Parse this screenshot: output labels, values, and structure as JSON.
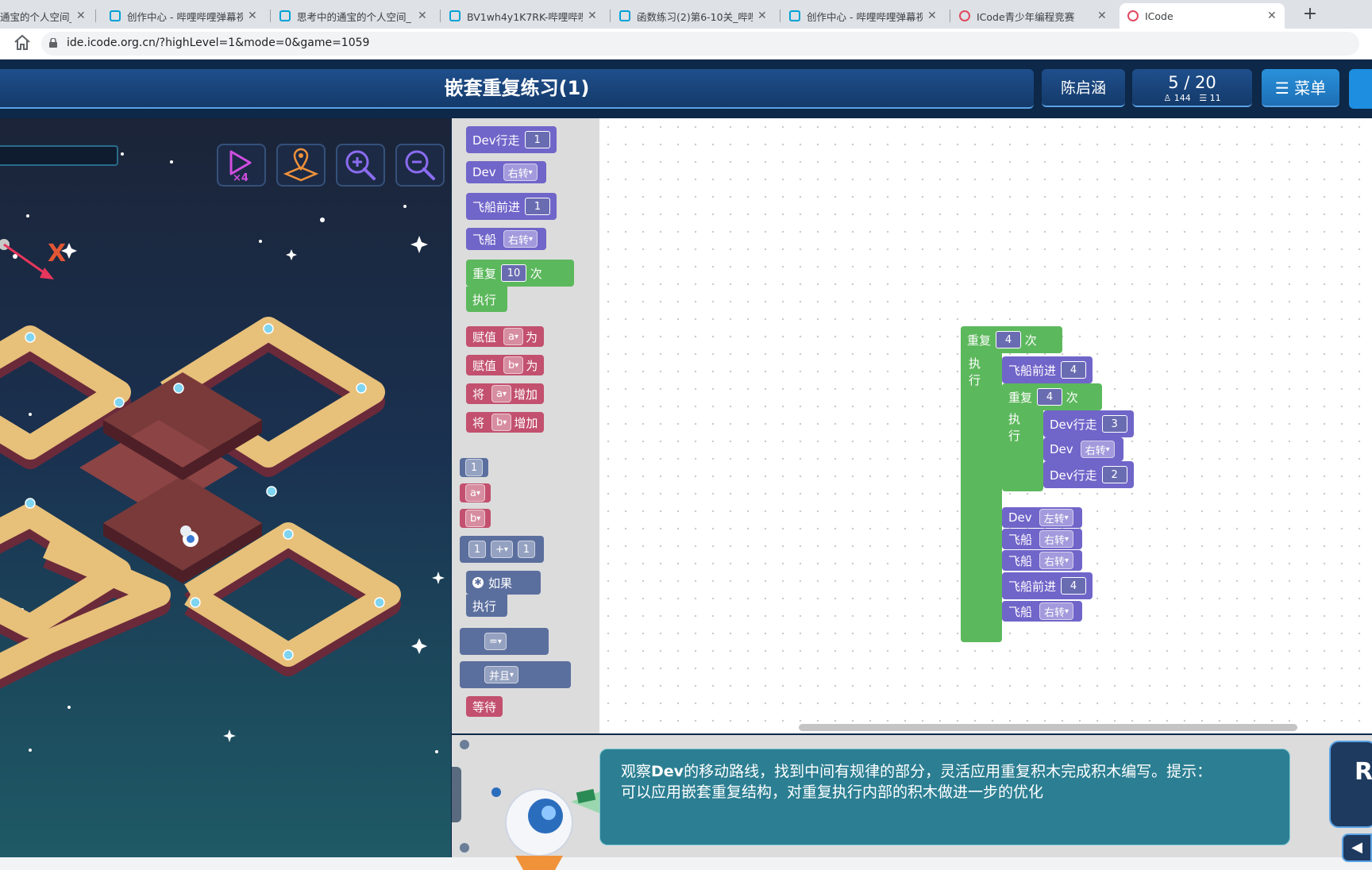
{
  "browser": {
    "tabs": [
      {
        "title": "通宝的个人空间_",
        "icon": "bilibili-icon"
      },
      {
        "title": "创作中心 - 哔哩哔哩弹幕视",
        "icon": "bilibili-icon"
      },
      {
        "title": "思考中的通宝的个人空间_",
        "icon": "bilibili-icon"
      },
      {
        "title": "BV1wh4y1K7RK-哔哩哔哩",
        "icon": "bilibili-icon"
      },
      {
        "title": "函数练习(2)第6-10关_哔哩",
        "icon": "bilibili-icon"
      },
      {
        "title": "创作中心 - 哔哩哔哩弹幕视",
        "icon": "bilibili-icon"
      },
      {
        "title": "ICode青少年编程竞赛",
        "icon": "icode-icon"
      },
      {
        "title": "ICode",
        "icon": "icode-icon"
      }
    ],
    "url": "ide.icode.org.cn/?highLevel=1&mode=0&game=1059"
  },
  "header": {
    "title": "嵌套重复练习(1)",
    "user": "陈启涵",
    "progress": "5 / 20",
    "stat_a": "144",
    "stat_b": "11",
    "menu": "菜单"
  },
  "stage": {
    "marker": "X",
    "speed": "×4",
    "buttons": [
      "speed-x4-icon",
      "map-pin-icon",
      "zoom-in-icon",
      "zoom-out-icon"
    ]
  },
  "palette": {
    "dev_walk": "Dev行走",
    "dev_walk_n": "1",
    "dev": "Dev",
    "dev_turn": "右转",
    "ship_fwd": "飞船前进",
    "ship_fwd_n": "1",
    "ship": "飞船",
    "ship_turn": "右转",
    "repeat": "重复",
    "repeat_n": "10",
    "times": "次",
    "exec": "执行",
    "assign": "赋值",
    "var_a": "a",
    "var_b": "b",
    "to": "为",
    "will": "将",
    "add": "增加",
    "num": "1",
    "plus": "+",
    "eq": "=",
    "and": "并且",
    "if": "如果",
    "wait": "等待"
  },
  "program": {
    "outer_repeat": "4",
    "ship_fwd_1": "4",
    "inner_repeat": "4",
    "dev_walk_1": "3",
    "dev_turn_1": "右转",
    "dev_walk_2": "2",
    "dev_turn_2": "左转",
    "ship_turn_1": "右转",
    "ship_turn_2": "右转",
    "ship_fwd_2": "4",
    "ship_turn_3": "右转"
  },
  "hint": {
    "line1_prefix": "观察",
    "dev": "Dev",
    "line1_suffix": "的移动路线，找到中间有规律的部分，灵活应用重复积木完成积木编写。提示：",
    "line2": "可以应用嵌套重复结构，对重复执行内部的积木做进一步的优化"
  },
  "run_button": "Ri"
}
